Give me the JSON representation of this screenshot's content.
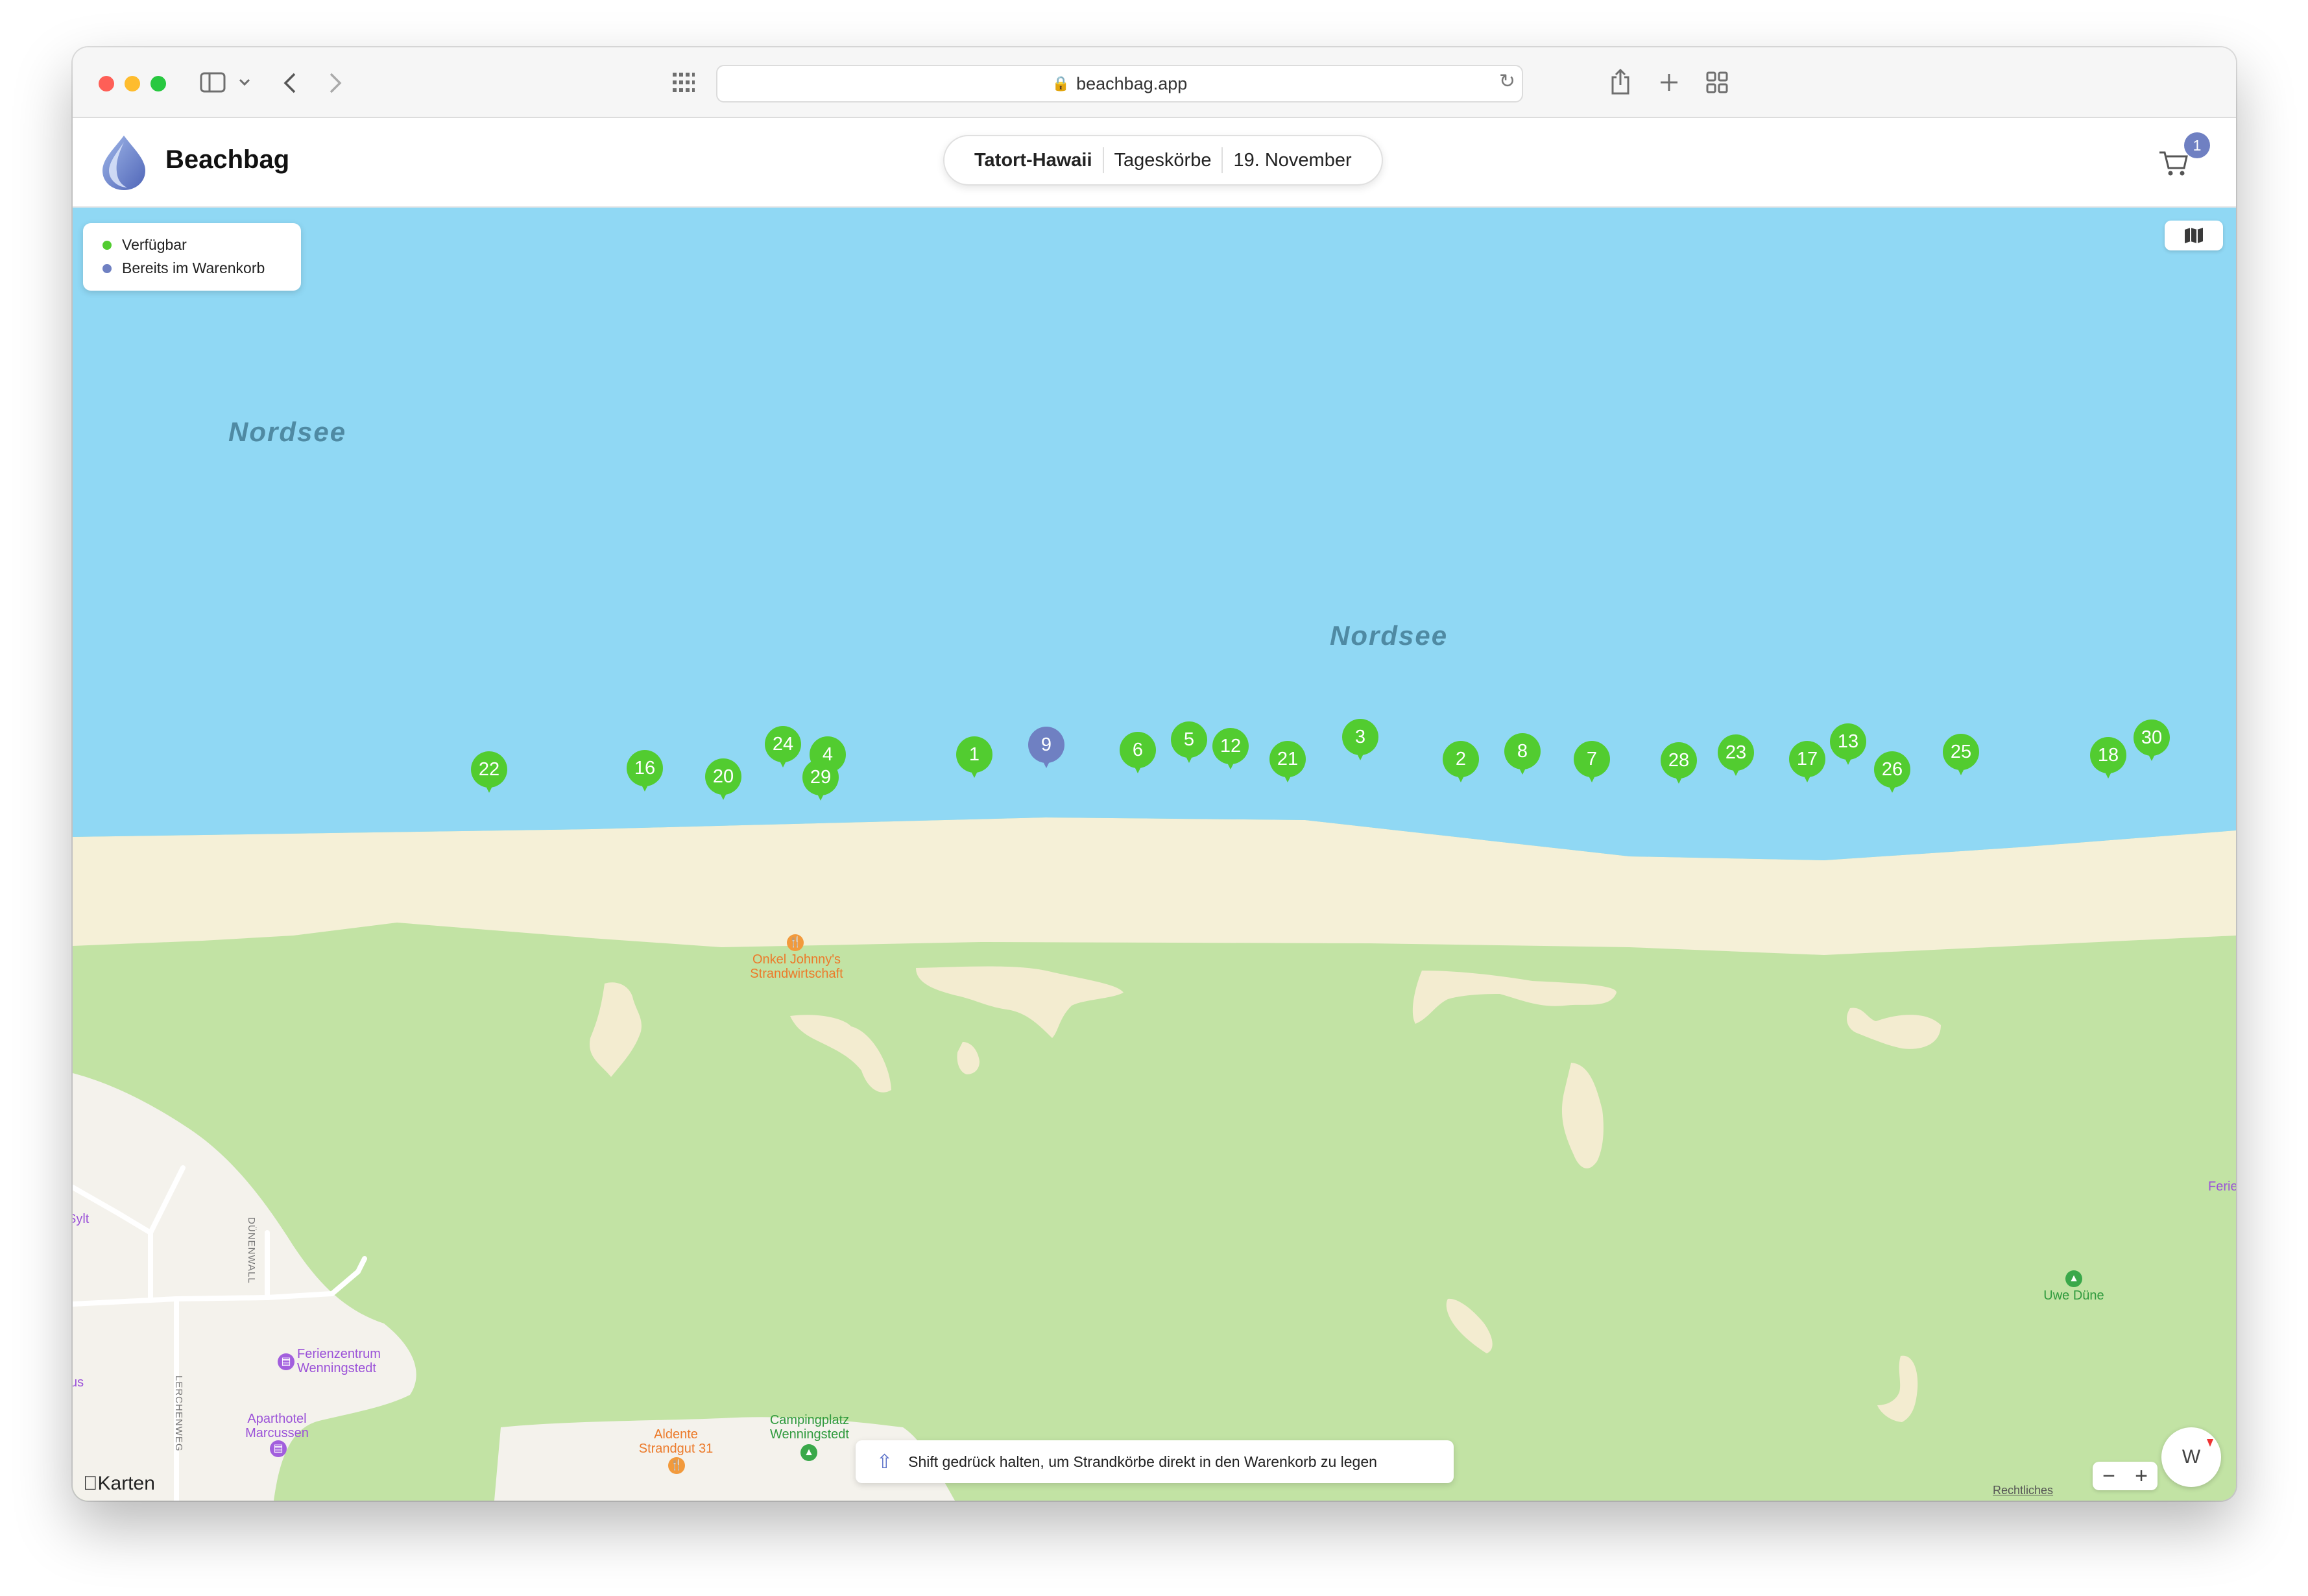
{
  "browser": {
    "url": "beachbag.app"
  },
  "header": {
    "brand": "Beachbag",
    "filter": {
      "location": "Tatort-Hawaii",
      "type": "Tageskörbe",
      "date": "19. November"
    },
    "cart_count": "1"
  },
  "legend": {
    "available": "Verfügbar",
    "in_cart": "Bereits im Warenkorb",
    "available_color": "#52cc30",
    "in_cart_color": "#6f80c2"
  },
  "map": {
    "sea_labels": [
      "Nordsee",
      "Nordsee"
    ],
    "pins": [
      {
        "label": "22",
        "status": "available"
      },
      {
        "label": "16",
        "status": "available"
      },
      {
        "label": "20",
        "status": "available"
      },
      {
        "label": "24",
        "status": "available"
      },
      {
        "label": "4",
        "status": "available"
      },
      {
        "label": "29",
        "status": "available"
      },
      {
        "label": "1",
        "status": "available"
      },
      {
        "label": "9",
        "status": "in_cart"
      },
      {
        "label": "6",
        "status": "available"
      },
      {
        "label": "5",
        "status": "available"
      },
      {
        "label": "12",
        "status": "available"
      },
      {
        "label": "21",
        "status": "available"
      },
      {
        "label": "3",
        "status": "available"
      },
      {
        "label": "2",
        "status": "available"
      },
      {
        "label": "8",
        "status": "available"
      },
      {
        "label": "7",
        "status": "available"
      },
      {
        "label": "28",
        "status": "available"
      },
      {
        "label": "23",
        "status": "available"
      },
      {
        "label": "17",
        "status": "available"
      },
      {
        "label": "13",
        "status": "available"
      },
      {
        "label": "26",
        "status": "available"
      },
      {
        "label": "25",
        "status": "available"
      },
      {
        "label": "18",
        "status": "available"
      },
      {
        "label": "30",
        "status": "available"
      }
    ],
    "pois": {
      "onkel_johnny": "Onkel Johnny's\nStrandwirtschaft",
      "uwe_duene": "Uwe Düne",
      "ferienzentrum": "Ferienzentrum\nWenningstedt",
      "aparthotel": "Aparthotel\nMarcussen",
      "aldente": "Aldente\nStrandgut 31",
      "camping": "Campingplatz\nWenningstedt",
      "sylt": "Sylt",
      "us": "us",
      "ferie": "Ferie"
    },
    "roads": {
      "duenenwall": "DÜNENWALL",
      "lerchenweg": "LERCHENWEG"
    },
    "hint": "Shift gedrück halten, um Strandkörbe direkt in den Warenkorb zu legen",
    "attribution": "Karten",
    "legal": "Rechtliches",
    "compass": "W"
  }
}
